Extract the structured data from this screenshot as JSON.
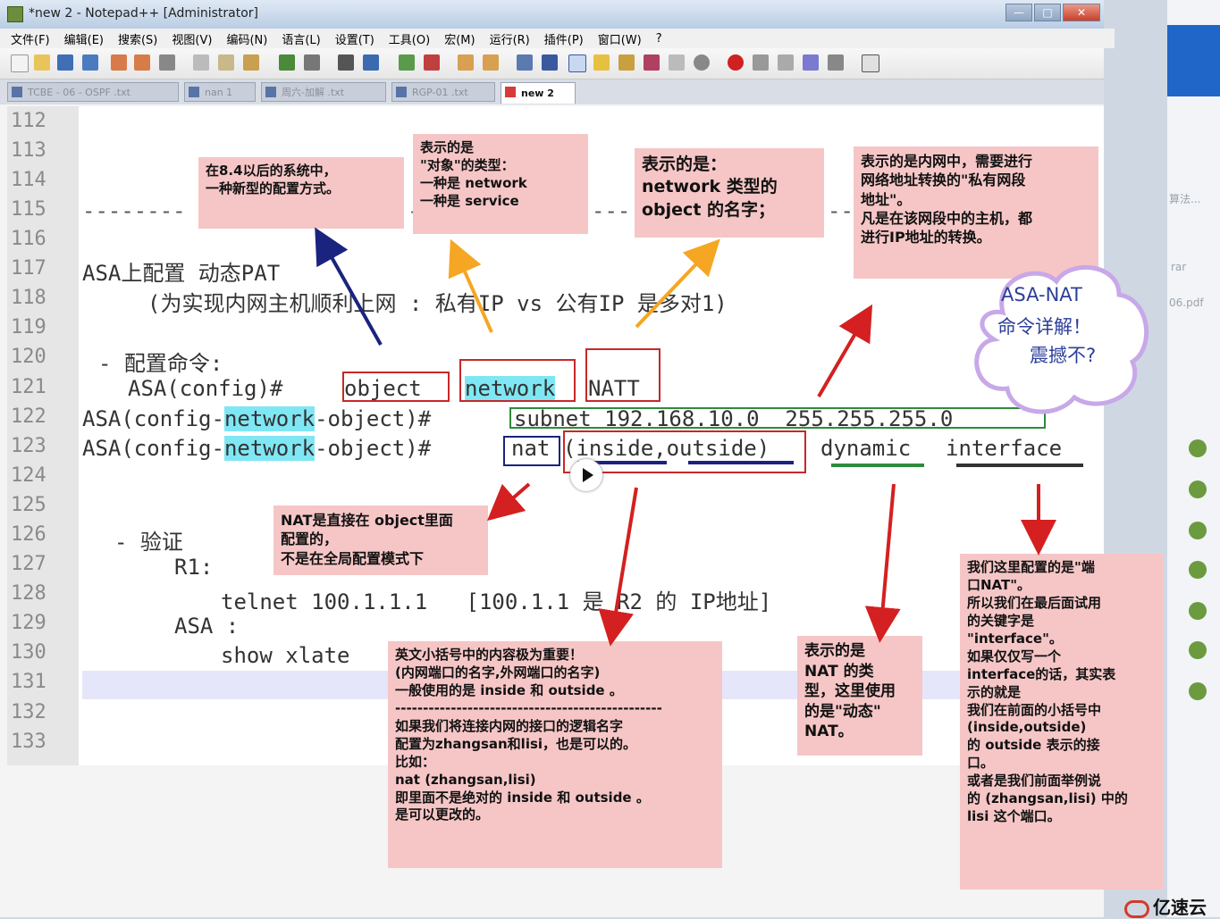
{
  "window": {
    "title": "*new 2 - Notepad++ [Administrator]",
    "controls": [
      "—",
      "□",
      "✕"
    ]
  },
  "menu": [
    "文件(F)",
    "编辑(E)",
    "搜索(S)",
    "视图(V)",
    "编码(N)",
    "语言(L)",
    "设置(T)",
    "工具(O)",
    "宏(M)",
    "运行(R)",
    "插件(P)",
    "窗口(W)",
    "?"
  ],
  "tabs": [
    {
      "label": "TCBE - 06 - OSPF .txt"
    },
    {
      "label": "nan 1"
    },
    {
      "label": "周六-加解 .txt"
    },
    {
      "label": "RGP-01 .txt"
    },
    {
      "label": "new 2",
      "active": true
    }
  ],
  "line_numbers": [
    "112",
    "113",
    "114",
    "115",
    "116",
    "117",
    "118",
    "119",
    "120",
    "121",
    "122",
    "123",
    "124",
    "125",
    "126",
    "127",
    "128",
    "129",
    "130",
    "131",
    "132",
    "133"
  ],
  "code": {
    "dashes_left": "--------",
    "dashes_mid1": "-",
    "dashes_mid2": "---",
    "dashes_right": "--",
    "l117": "ASA上配置 动态PAT",
    "l118": "(为实现内网主机顺利上网 : 私有IP vs 公有IP 是多对1)",
    "l120": "- 配置命令:",
    "l121_prefix": "ASA(config)#",
    "l121_object": "object",
    "l121_network": "network",
    "l121_natt": "NATT",
    "l122_a": "ASA(config-",
    "l122_b": "network",
    "l122_c": "-object)#",
    "l122_subnet": "subnet 192.168.10.0  255.255.255.0",
    "l123_a": "ASA(config-",
    "l123_b": "network",
    "l123_c": "-object)#",
    "l123_nat": "nat",
    "l123_paren": "(inside,outside)",
    "l123_dynamic": "dynamic",
    "l123_interface": "interface",
    "l126": "- 验证",
    "l127": "R1:",
    "l128": "telnet 100.1.1.1   [100.1.1 是 R2 的 IP地址]",
    "l129": "ASA :",
    "l130": "show xlate"
  },
  "notes": {
    "n1": "在8.4以后的系统中，\n一种新型的配置方式。",
    "n2": "表示的是\n\"对象\"的类型：\n一种是 network\n一种是 service",
    "n3": "表示的是：\nnetwork 类型的\nobject 的名字；",
    "n4": "表示的是内网中，需要进行\n网络地址转换的\"私有网段\n地址\"。\n凡是在该网段中的主机，都\n进行IP地址的转换。",
    "n5": "NAT是直接在 object里面\n配置的，\n不是在全局配置模式下",
    "n6": "英文小括号中的内容极为重要！\n(内网端口的名字,外网端口的名字)\n一般使用的是 inside 和 outside 。\n------------------------------------------------\n如果我们将连接内网的接口的逻辑名字\n配置为zhangsan和lisi，也是可以的。\n比如：\nnat (zhangsan,lisi)\n即里面不是绝对的 inside 和 outside 。\n是可以更改的。",
    "n7": "表示的是\nNAT 的类\n型，这里使用\n的是\"动态\"\nNAT。",
    "n8": "我们这里配置的是\"端\n口NAT\"。\n所以我们在最后面试用\n的关键字是\n\"interface\"。\n如果仅仅写一个\ninterface的话，其实表\n示的就是\n我们在前面的小括号中\n(inside,outside)\n的 outside 表示的接\n口。\n或者是我们前面举例说\n的 (zhangsan,lisi) 中的\nlisi 这个端口。"
  },
  "cloud": {
    "line1": "ASA-NAT",
    "line2": "命令详解！",
    "line3": "震撼不?"
  },
  "sidepanel": {
    "texts": [
      "算法...",
      "rar",
      "06.pdf"
    ]
  },
  "logo": "亿速云",
  "colors": {
    "note_bg": "#f6c6c6",
    "highlight": "#7fe7f3",
    "arrow_red": "#d42020",
    "arrow_orange": "#f5a623",
    "arrow_navy": "#1a237e"
  }
}
